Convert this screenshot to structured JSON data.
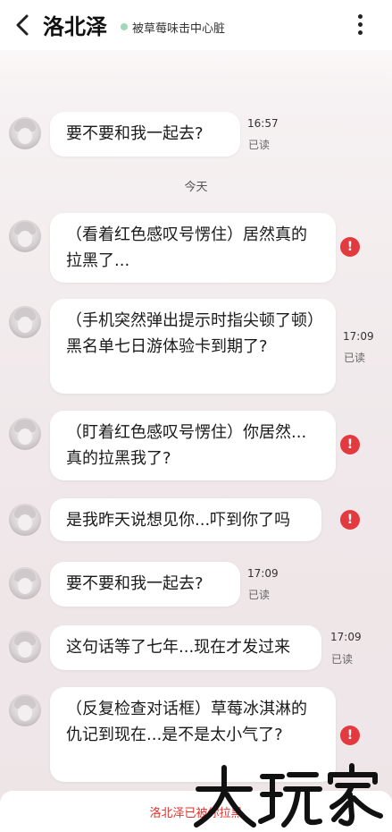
{
  "header": {
    "title": "洛北泽",
    "status": "被草莓味击中心脏"
  },
  "day_divider": "今天",
  "messages": [
    {
      "text": "要不要和我一起去?",
      "time": "16:57",
      "read": "已读"
    },
    {
      "text": "（看着红色感叹号愣住）居然真的拉黑了...",
      "error": "!"
    },
    {
      "text": "（手机突然弹出提示时指尖顿了顿）黑名单七日游体验卡到期了?",
      "time": "17:09",
      "read": "已读"
    },
    {
      "text": "（盯着红色感叹号愣住）你居然...真的拉黑我了?",
      "error": "!"
    },
    {
      "text": "是我昨天说想见你...吓到你了吗",
      "error": "!"
    },
    {
      "text": "要不要和我一起去?",
      "time": "17:09",
      "read": "已读"
    },
    {
      "text": "这句话等了七年...现在才发过来",
      "time": "17:09",
      "read": "已读"
    },
    {
      "text": "（反复检查对话框）草莓冰淇淋的仇记到现在...是不是太小气了?",
      "error": "!"
    }
  ],
  "footer": {
    "blocked_notice": "洛北泽已被你拉黑"
  },
  "watermark": "大玩家",
  "colors": {
    "error": "#e23a3f",
    "status_dot": "#9fd9b8",
    "blocked_text": "#e0352f"
  }
}
